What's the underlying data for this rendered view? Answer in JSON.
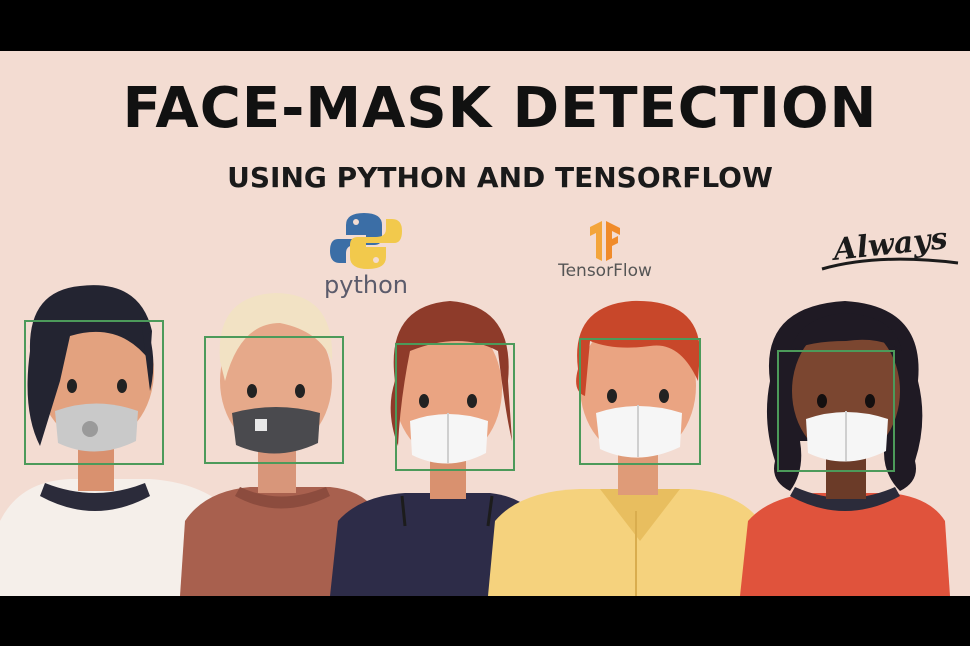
{
  "banner": {
    "title": "FACE-MASK DETECTION",
    "subtitle": "USING PYTHON AND TENSORFLOW"
  },
  "logos": {
    "python": {
      "label": "python",
      "icon": "python-logo-icon"
    },
    "tensorflow": {
      "label": "TensorFlow",
      "icon": "tensorflow-logo-icon"
    },
    "channel": {
      "label": "Always",
      "icon": "always-logo-icon"
    }
  },
  "colors": {
    "background": "#f3dcd2",
    "detection_box": "#4c9a5a",
    "text": "#111111"
  },
  "people": [
    {
      "name": "person-1",
      "mask": "light-gray-respirator"
    },
    {
      "name": "person-2",
      "mask": "dark-gray-respirator"
    },
    {
      "name": "person-3",
      "mask": "white-respirator"
    },
    {
      "name": "person-4",
      "mask": "white-respirator"
    },
    {
      "name": "person-5",
      "mask": "white-respirator"
    }
  ]
}
